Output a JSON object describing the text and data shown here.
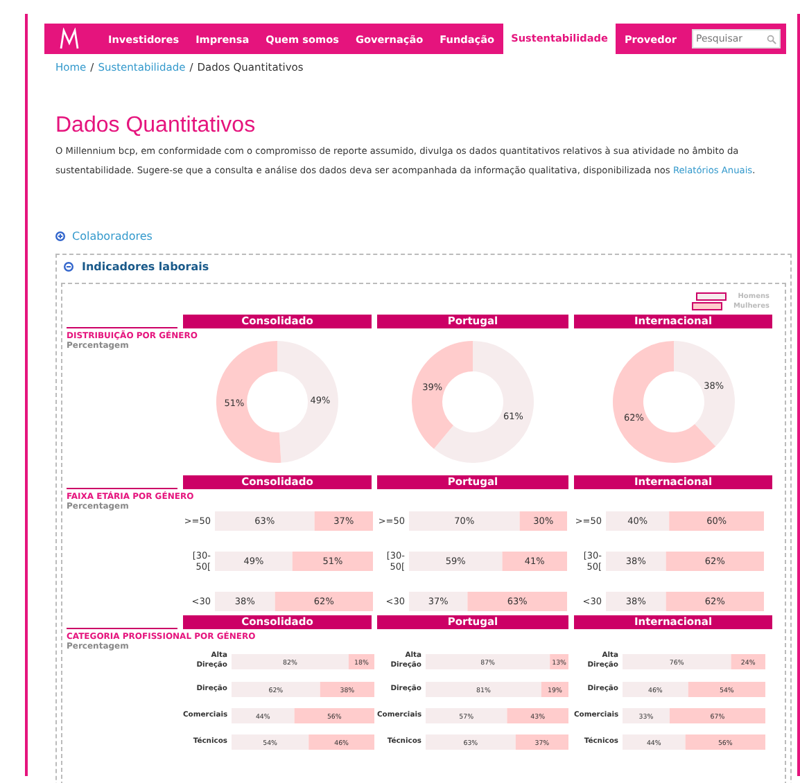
{
  "nav": {
    "items": [
      {
        "label": "Investidores",
        "selected": false
      },
      {
        "label": "Imprensa",
        "selected": false
      },
      {
        "label": "Quem somos",
        "selected": false
      },
      {
        "label": "Governação",
        "selected": false
      },
      {
        "label": "Fundação",
        "selected": false
      },
      {
        "label": "Sustentabilidade",
        "selected": true
      },
      {
        "label": "Provedor",
        "selected": false
      }
    ],
    "search": {
      "placeholder": "Pesquisar"
    }
  },
  "breadcrumb": {
    "separator": "/",
    "items": [
      {
        "label": "Home",
        "link": true
      },
      {
        "label": "Sustentabilidade",
        "link": true
      },
      {
        "label": "Dados Quantitativos",
        "link": false
      }
    ]
  },
  "title": "Dados Quantitativos",
  "intro": {
    "text": "O Millennium bcp, em conformidade com o compromisso de reporte assumido, divulga os dados quantitativos relativos à sua atividade no âmbito da sustentabilidade. Sugere-se que a consulta e análise dos dados deva ser acompanhada da informação qualitativa, disponibilizada nos ",
    "link": "Relatórios Anuais",
    "after": "."
  },
  "sections": [
    {
      "label": "Colaboradores",
      "expanded": false
    }
  ],
  "panel": {
    "label": "Indicadores laborais",
    "expanded": true,
    "legend": [
      {
        "label": "Homens",
        "color": "#f6eced"
      },
      {
        "label": "Mulheres",
        "color": "#ffcccc"
      }
    ],
    "blocks": [
      {
        "kind": "donut",
        "title": "DISTRIBUIÇÃO POR GÉNERO",
        "subtitle": "Percentagem",
        "columns": [
          {
            "name": "Consolidado",
            "chart_data": {
              "type": "donut",
              "values": [
                49,
                51
              ],
              "value_labels": [
                "49%",
                "51%"
              ]
            }
          },
          {
            "name": "Portugal",
            "chart_data": {
              "type": "donut",
              "values": [
                61,
                39
              ],
              "value_labels": [
                "61%",
                "39%"
              ]
            }
          },
          {
            "name": "Internacional",
            "chart_data": {
              "type": "donut",
              "values": [
                38,
                62
              ],
              "value_labels": [
                "38%",
                "62%"
              ]
            }
          }
        ]
      },
      {
        "kind": "bars",
        "title": "FAIXA ETÁRIA POR GÉNERO",
        "subtitle": "Percentagem",
        "columns": [
          {
            "name": "Consolidado",
            "chart_data": {
              "type": "bar",
              "orientation": "horizontal",
              "stacked": true,
              "categories": [
                ">=50",
                "[30-50[",
                "<30"
              ],
              "series": [
                {
                  "color": "#f6eced",
                  "values": [
                    63,
                    49,
                    38
                  ],
                  "value_labels": [
                    "63%",
                    "49%",
                    "38%"
                  ]
                },
                {
                  "color": "#ffcccc",
                  "values": [
                    37,
                    51,
                    62
                  ],
                  "value_labels": [
                    "37%",
                    "51%",
                    "62%"
                  ]
                }
              ]
            }
          },
          {
            "name": "Portugal",
            "chart_data": {
              "type": "bar",
              "orientation": "horizontal",
              "stacked": true,
              "categories": [
                ">=50",
                "[30-50[",
                "<30"
              ],
              "series": [
                {
                  "color": "#f6eced",
                  "values": [
                    70,
                    59,
                    37
                  ],
                  "value_labels": [
                    "70%",
                    "59%",
                    "37%"
                  ]
                },
                {
                  "color": "#ffcccc",
                  "values": [
                    30,
                    41,
                    63
                  ],
                  "value_labels": [
                    "30%",
                    "41%",
                    "63%"
                  ]
                }
              ]
            }
          },
          {
            "name": "Internacional",
            "chart_data": {
              "type": "bar",
              "orientation": "horizontal",
              "stacked": true,
              "categories": [
                ">=50",
                "[30-50[",
                "<30"
              ],
              "series": [
                {
                  "color": "#f6eced",
                  "values": [
                    40,
                    38,
                    38
                  ],
                  "value_labels": [
                    "40%",
                    "38%",
                    "38%"
                  ]
                },
                {
                  "color": "#ffcccc",
                  "values": [
                    60,
                    62,
                    62
                  ],
                  "value_labels": [
                    "60%",
                    "62%",
                    "62%"
                  ]
                }
              ]
            }
          }
        ]
      },
      {
        "kind": "bars-compact",
        "title": "CATEGORIA PROFISSIONAL POR GÉNERO",
        "subtitle": "Percentagem",
        "columns": [
          {
            "name": "Consolidado",
            "chart_data": {
              "type": "bar",
              "orientation": "horizontal",
              "stacked": true,
              "categories": [
                "Alta Direção",
                "Direção",
                "Comerciais",
                "Técnicos"
              ],
              "series": [
                {
                  "color": "#f6eced",
                  "values": [
                    82,
                    62,
                    44,
                    54
                  ],
                  "value_labels": [
                    "82%",
                    "62%",
                    "44%",
                    "54%"
                  ]
                },
                {
                  "color": "#ffcccc",
                  "values": [
                    18,
                    38,
                    56,
                    46
                  ],
                  "value_labels": [
                    "18%",
                    "38%",
                    "56%",
                    "46%"
                  ]
                }
              ]
            }
          },
          {
            "name": "Portugal",
            "chart_data": {
              "type": "bar",
              "orientation": "horizontal",
              "stacked": true,
              "categories": [
                "Alta Direção",
                "Direção",
                "Comerciais",
                "Técnicos"
              ],
              "series": [
                {
                  "color": "#f6eced",
                  "values": [
                    87,
                    81,
                    57,
                    63
                  ],
                  "value_labels": [
                    "87%",
                    "81%",
                    "57%",
                    "63%"
                  ]
                },
                {
                  "color": "#ffcccc",
                  "values": [
                    13,
                    19,
                    43,
                    37
                  ],
                  "value_labels": [
                    "13%",
                    "19%",
                    "43%",
                    "37%"
                  ]
                }
              ]
            }
          },
          {
            "name": "Internacional",
            "chart_data": {
              "type": "bar",
              "orientation": "horizontal",
              "stacked": true,
              "categories": [
                "Alta Direção",
                "Direção",
                "Comerciais",
                "Técnicos"
              ],
              "series": [
                {
                  "color": "#f6eced",
                  "values": [
                    76,
                    46,
                    33,
                    44
                  ],
                  "value_labels": [
                    "76%",
                    "46%",
                    "33%",
                    "44%"
                  ]
                },
                {
                  "color": "#ffcccc",
                  "values": [
                    24,
                    54,
                    67,
                    56
                  ],
                  "value_labels": [
                    "24%",
                    "54%",
                    "67%",
                    "56%"
                  ]
                }
              ]
            }
          }
        ]
      }
    ]
  }
}
